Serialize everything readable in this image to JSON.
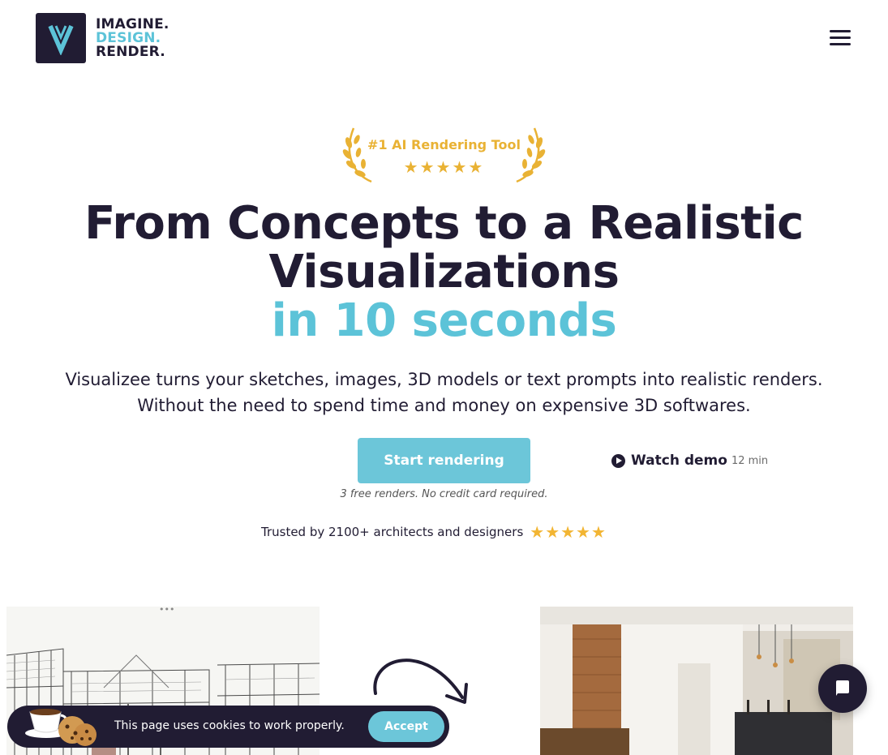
{
  "header": {
    "logo": {
      "line1": "IMAGINE.",
      "line2": "DESIGN.",
      "line3": "RENDER."
    },
    "menu_icon": "hamburger-menu-icon"
  },
  "badge": {
    "title": "#1 AI Rendering Tool",
    "stars": "★★★★★",
    "rating": 5
  },
  "hero": {
    "headline_line1": "From Concepts to a Realistic",
    "headline_line2": "Visualizations",
    "headline_accent": "in 10 seconds",
    "subtext_line1": "Visualizee turns your sketches, images, 3D models or text prompts into realistic renders.",
    "subtext_line2": "Without the need to spend time and money on expensive 3D softwares."
  },
  "cta": {
    "primary_label": "Start rendering",
    "demo_label": "Watch demo",
    "demo_duration": "12 min",
    "note": "3 free renders. No credit card required."
  },
  "trust": {
    "text": "Trusted by 2100+ architects and designers",
    "stars": "★★★★★",
    "rating": 5
  },
  "cookie": {
    "text": "This page uses cookies to work properly.",
    "accept_label": "Accept"
  },
  "colors": {
    "dark": "#211c33",
    "accent": "#5cc3d8",
    "gold": "#e9b234",
    "button": "#6cc6d9"
  }
}
